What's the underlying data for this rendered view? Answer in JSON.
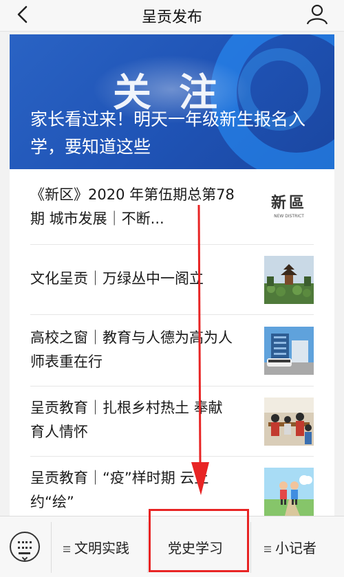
{
  "header": {
    "title": "呈贡发布"
  },
  "banner": {
    "big_text": "关注",
    "headline": "家长看过来！明天一年级新生报名入学，要知道这些"
  },
  "articles": [
    {
      "title": "《新区》2020 年第伍期总第78期 城市发展｜不断...",
      "thumb_logo": "新區",
      "thumb_sub": "NEW DISTRICT"
    },
    {
      "title": "文化呈贡｜万绿丛中一阁立"
    },
    {
      "title": "高校之窗｜教育与人德为高为人师表重在行"
    },
    {
      "title": "呈贡教育｜扎根乡村热土 奉献育人情怀"
    },
    {
      "title": "呈贡教育｜“疫”样时期 云上约“绘”"
    }
  ],
  "bottom_menu": [
    {
      "label": "文明实践"
    },
    {
      "label": "党史学习"
    },
    {
      "label": "小记者"
    }
  ],
  "colors": {
    "annotation": "#e82424",
    "banner": "#1f53b5"
  }
}
